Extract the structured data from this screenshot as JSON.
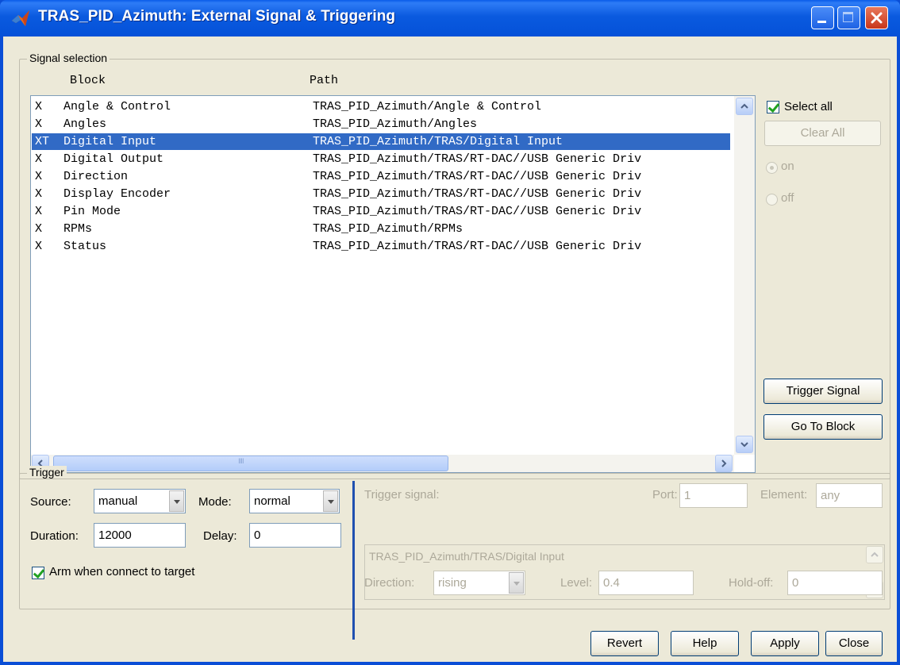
{
  "window": {
    "title": "TRAS_PID_Azimuth: External Signal & Triggering"
  },
  "signal_selection": {
    "label": "Signal selection",
    "columns": {
      "block": "Block",
      "path": "Path"
    },
    "rows": [
      {
        "flag": "X",
        "block": "Angle & Control",
        "path": "TRAS_PID_Azimuth/Angle & Control",
        "selected": false
      },
      {
        "flag": "X",
        "block": "Angles",
        "path": "TRAS_PID_Azimuth/Angles",
        "selected": false
      },
      {
        "flag": "XT",
        "block": "Digital Input",
        "path": "TRAS_PID_Azimuth/TRAS/Digital Input",
        "selected": true
      },
      {
        "flag": "X",
        "block": "Digital Output",
        "path": "TRAS_PID_Azimuth/TRAS/RT-DAC//USB Generic Driv",
        "selected": false
      },
      {
        "flag": "X",
        "block": "Direction",
        "path": "TRAS_PID_Azimuth/TRAS/RT-DAC//USB Generic Driv",
        "selected": false
      },
      {
        "flag": "X",
        "block": "Display Encoder",
        "path": "TRAS_PID_Azimuth/TRAS/RT-DAC//USB Generic Driv",
        "selected": false
      },
      {
        "flag": "X",
        "block": "Pin Mode",
        "path": "TRAS_PID_Azimuth/TRAS/RT-DAC//USB Generic Driv",
        "selected": false
      },
      {
        "flag": "X",
        "block": "RPMs",
        "path": "TRAS_PID_Azimuth/RPMs",
        "selected": false
      },
      {
        "flag": "X",
        "block": "Status",
        "path": "TRAS_PID_Azimuth/TRAS/RT-DAC//USB Generic Driv",
        "selected": false
      }
    ],
    "select_all_label": "Select all",
    "clear_all_label": "Clear All",
    "on_label": "on",
    "off_label": "off",
    "trigger_signal_label": "Trigger Signal",
    "go_to_block_label": "Go To Block",
    "hscroll_grip": "IIII"
  },
  "trigger": {
    "label": "Trigger",
    "source_label": "Source:",
    "source_value": "manual",
    "mode_label": "Mode:",
    "mode_value": "normal",
    "duration_label": "Duration:",
    "duration_value": "12000",
    "delay_label": "Delay:",
    "delay_value": "0",
    "arm_label": "Arm when connect to target",
    "trigger_signal_label": "Trigger signal:",
    "port_label": "Port:",
    "port_value": "1",
    "element_label": "Element:",
    "element_value": "any",
    "signal_path": "TRAS_PID_Azimuth/TRAS/Digital Input",
    "direction_label": "Direction:",
    "direction_value": "rising",
    "level_label": "Level:",
    "level_value": "0.4",
    "holdoff_label": "Hold-off:",
    "holdoff_value": "0"
  },
  "footer": {
    "revert": "Revert",
    "help": "Help",
    "apply": "Apply",
    "close": "Close"
  },
  "colors": {
    "titlebar": "#0a5adf",
    "selection": "#316ac5",
    "dialog_bg": "#ece9d8"
  }
}
